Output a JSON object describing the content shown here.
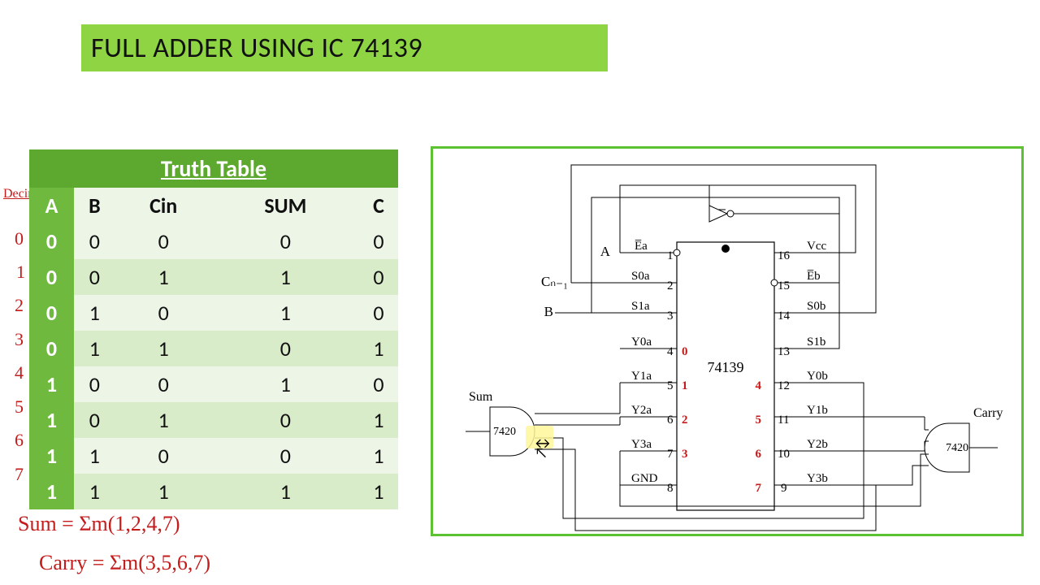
{
  "title": "FULL ADDER USING IC 74139",
  "truth_table": {
    "caption": "Truth Table",
    "headers": [
      "A",
      "B",
      "Cin",
      "SUM",
      "C"
    ],
    "rows": [
      [
        "0",
        "0",
        "0",
        "0",
        "0"
      ],
      [
        "0",
        "0",
        "1",
        "1",
        "0"
      ],
      [
        "0",
        "1",
        "0",
        "1",
        "0"
      ],
      [
        "0",
        "1",
        "1",
        "0",
        "1"
      ],
      [
        "1",
        "0",
        "0",
        "1",
        "0"
      ],
      [
        "1",
        "0",
        "1",
        "0",
        "1"
      ],
      [
        "1",
        "1",
        "0",
        "0",
        "1"
      ],
      [
        "1",
        "1",
        "1",
        "1",
        "1"
      ]
    ]
  },
  "annotations": {
    "decimal_label": "Decimal",
    "row_indices": [
      "0",
      "1",
      "2",
      "3",
      "4",
      "5",
      "6",
      "7"
    ],
    "eq_sum": "Sum = Σm(1,2,4,7)",
    "eq_carry": "Carry = Σm(3,5,6,7)"
  },
  "diagram": {
    "ic_label": "74139",
    "inputs": {
      "A": "A",
      "B": "B",
      "Cn": "Cₙ₋₁"
    },
    "outputs": {
      "sum": "Sum",
      "carry": "Carry"
    },
    "gates": {
      "left": "7420",
      "right": "7420"
    },
    "pins_left": [
      {
        "name": "E̅a",
        "num": "1"
      },
      {
        "name": "S0a",
        "num": "2"
      },
      {
        "name": "S1a",
        "num": "3"
      },
      {
        "name": "Y0a",
        "num": "4",
        "red": "0"
      },
      {
        "name": "Y1a",
        "num": "5",
        "red": "1"
      },
      {
        "name": "Y2a",
        "num": "6",
        "red": "2"
      },
      {
        "name": "Y3a",
        "num": "7",
        "red": "3"
      },
      {
        "name": "GND",
        "num": "8"
      }
    ],
    "pins_right": [
      {
        "name": "Vcc",
        "num": "16"
      },
      {
        "name": "E̅b",
        "num": "15"
      },
      {
        "name": "S0b",
        "num": "14"
      },
      {
        "name": "S1b",
        "num": "13"
      },
      {
        "name": "Y0b",
        "num": "12",
        "red": "4"
      },
      {
        "name": "Y1b",
        "num": "11",
        "red": "5"
      },
      {
        "name": "Y2b",
        "num": "10",
        "red": "6"
      },
      {
        "name": "Y3b",
        "num": "9",
        "red": "7"
      }
    ]
  }
}
